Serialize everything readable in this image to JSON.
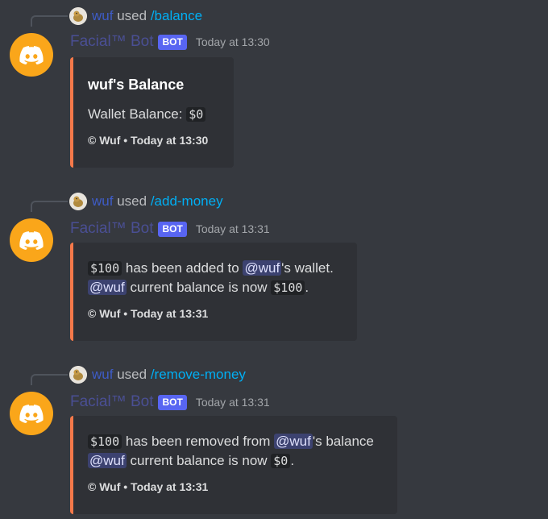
{
  "messages": [
    {
      "reply": {
        "user": "wuf",
        "used": "used",
        "command": "/balance"
      },
      "author": {
        "name": "Facial™ Bot",
        "tag": "BOT",
        "timestamp": "Today at 13:30"
      },
      "embed": {
        "title": "wuf's Balance",
        "desc_label": "Wallet Balance:",
        "desc_value": "$0",
        "footer": "© Wuf • Today at 13:30"
      }
    },
    {
      "reply": {
        "user": "wuf",
        "used": "used",
        "command": "/add-money"
      },
      "author": {
        "name": "Facial™ Bot",
        "tag": "BOT",
        "timestamp": "Today at 13:31"
      },
      "embed": {
        "amount": "$100",
        "line1_mid": "has been added to",
        "mention": "@wuf",
        "line1_end": "'s wallet.",
        "line2_mid": "current balance is now",
        "balance": "$100",
        "period": ".",
        "footer": "© Wuf • Today at 13:31"
      }
    },
    {
      "reply": {
        "user": "wuf",
        "used": "used",
        "command": "/remove-money"
      },
      "author": {
        "name": "Facial™ Bot",
        "tag": "BOT",
        "timestamp": "Today at 13:31"
      },
      "embed": {
        "amount": "$100",
        "line1_mid": "has been removed from",
        "mention": "@wuf",
        "line1_end": "'s balance",
        "line2_mid": "current balance is now",
        "balance": "$0",
        "period": ".",
        "footer": "© Wuf • Today at 13:31"
      }
    }
  ],
  "colors": {
    "background": "#36393f",
    "embed_bg": "#2f3136",
    "embed_accent": "#f5794a",
    "bot_avatar": "#faa61a",
    "bot_tag": "#5865f2",
    "command": "#00aff4",
    "mention_bg": "#3c4270"
  },
  "icons": {
    "bot_avatar": "discord-logo-icon",
    "user_avatar": "duck-avatar-icon"
  }
}
